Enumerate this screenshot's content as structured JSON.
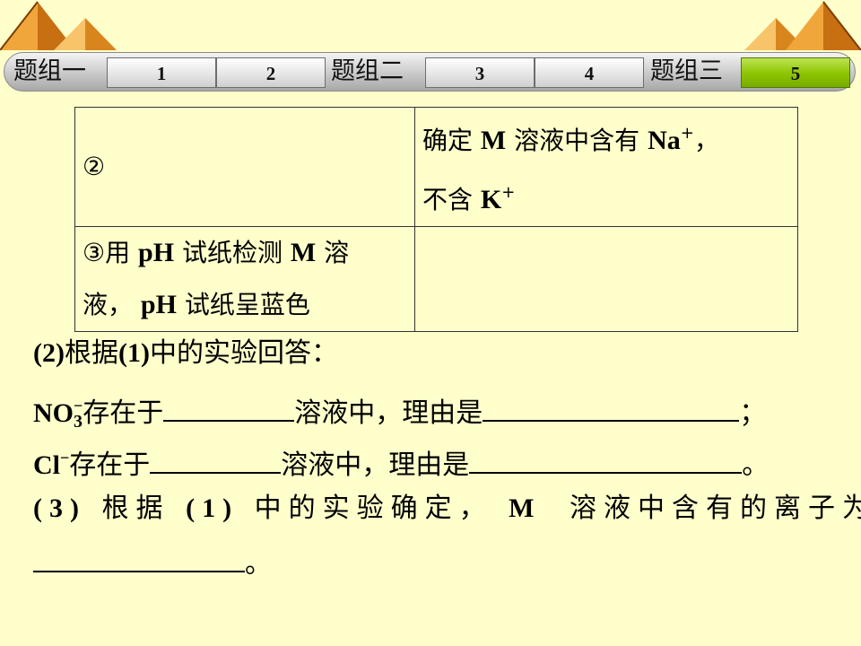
{
  "nav": {
    "group1": "题组一",
    "group2": "题组二",
    "group3": "题组三",
    "buttons": [
      "1",
      "2",
      "3",
      "4",
      "5"
    ],
    "active": "5"
  },
  "table": {
    "r1c1": "②",
    "r1c2_a": "确定",
    "r1c2_m": "M",
    "r1c2_b": "溶液中含有",
    "r1c2_na": "Na",
    "r1c2_plus": "+",
    "r1c2_comma": "，",
    "r1c2_c": "不含",
    "r1c2_k": "K",
    "r1c2_plus2": "+",
    "r2c1_a": "③用",
    "r2c1_ph": "pH",
    "r2c1_b": "试纸检测",
    "r2c1_m": "M",
    "r2c1_c": "溶",
    "r2c1_d": "液，",
    "r2c1_ph2": "pH",
    "r2c1_e": "试纸呈蓝色",
    "r2c2": ""
  },
  "q2": {
    "num": "(2)",
    "text_a": "根据",
    "ref": "(1)",
    "text_b": "中的实验回答："
  },
  "no3": {
    "formula": "NO",
    "sub": "3",
    "charge": "−",
    "text_a": "存在于",
    "text_b": "溶液中，理由是",
    "end": "；"
  },
  "cl": {
    "formula": "Cl",
    "charge": "−",
    "text_a": "存在于",
    "text_b": "溶液中，理由是",
    "end": "。"
  },
  "q3": {
    "num": "(3)",
    "text_a": "根据",
    "ref": "(1)",
    "text_b": "中的实验确定，",
    "m": "M",
    "text_c": "溶液中含有的离子为",
    "end": "。"
  },
  "colors": {
    "background": "#ffffcc",
    "active_button": "#8cc400",
    "deco_orange": "#e8901e"
  }
}
